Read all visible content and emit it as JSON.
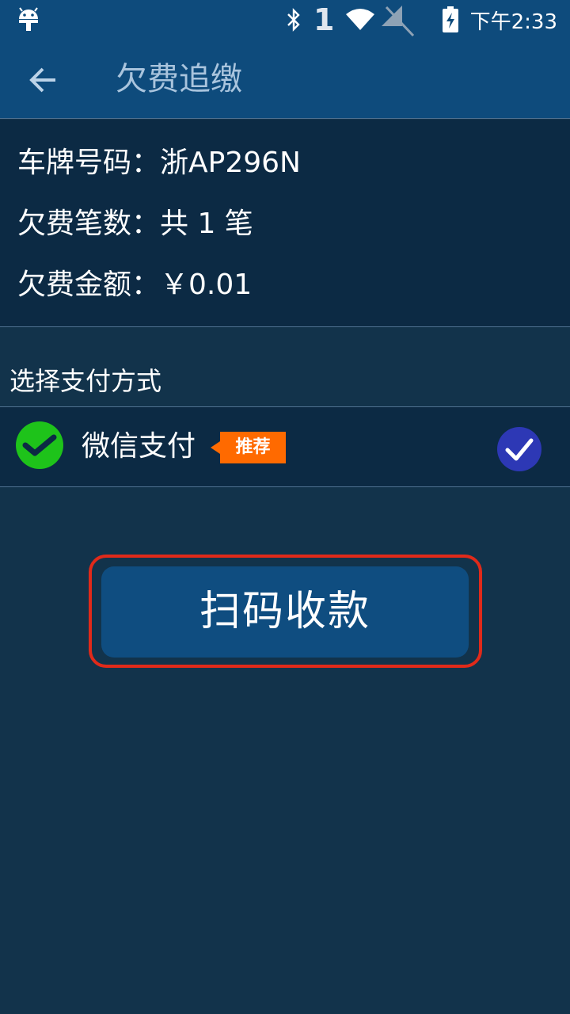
{
  "status_bar": {
    "sim_indicator": "1",
    "time": "下午2:33",
    "icons": [
      "android-icon",
      "bluetooth-icon",
      "wifi-icon",
      "signal-off-icon",
      "battery-charging-icon"
    ]
  },
  "app_bar": {
    "back_icon": "arrow-left-icon",
    "title": "欠费追缴"
  },
  "arrears": {
    "plate": "车牌号码：浙AP296N",
    "count": "欠费笔数：共 1 笔",
    "amount": "欠费金额：￥0.01"
  },
  "payment": {
    "heading": "选择支付方式",
    "method_icon": "wechat-pay-icon",
    "method_label": "微信支付",
    "badge": "推荐",
    "selected": true
  },
  "action": {
    "scan_label": "扫码收款"
  },
  "colors": {
    "header_bg": "#0e4b7c",
    "page_bg": "#12334b",
    "panel_bg": "#0c2a44",
    "badge": "#ff6a00",
    "wechat_green": "#1ec31a",
    "check_bg": "#2d38b5",
    "highlight_outline": "#e02a1a",
    "button_bg": "#0f4d80"
  }
}
